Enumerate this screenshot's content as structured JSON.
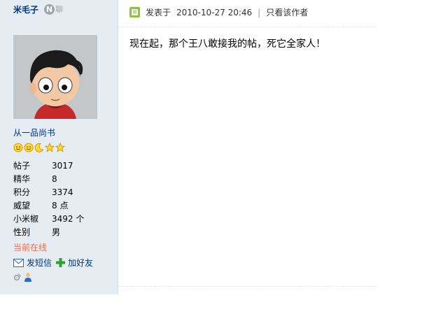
{
  "user": {
    "name": "米毛子",
    "chat_label": "聊",
    "chat_icon_glyph": "N",
    "rank": "从一品尚书",
    "stats": [
      {
        "key": "帖子",
        "value": "3017"
      },
      {
        "key": "精华",
        "value": "8"
      },
      {
        "key": "积分",
        "value": "3374"
      },
      {
        "key": "威望",
        "value": "8 点"
      },
      {
        "key": "小米椒",
        "value": "3492 个"
      },
      {
        "key": "性别",
        "value": "男"
      }
    ],
    "status": "当前在线",
    "actions": {
      "message": "发短信",
      "add_friend": "加好友"
    }
  },
  "post": {
    "posted_prefix": "发表于",
    "timestamp": "2010-10-27 20:46",
    "separator": "|",
    "view_author_only": "只看该作者",
    "message": "现在起，那个王八敢接我的帖，死它全家人！"
  },
  "colors": {
    "sidebar_bg": "#e5edf2",
    "username": "#00337f",
    "online_status": "#f26c4f",
    "online_icon": "#8ac43f"
  },
  "icons": [
    "chat-icon",
    "smile-icon",
    "moon-icon",
    "star-icon",
    "envelope-icon",
    "plus-icon",
    "user-icon",
    "online-icon"
  ]
}
